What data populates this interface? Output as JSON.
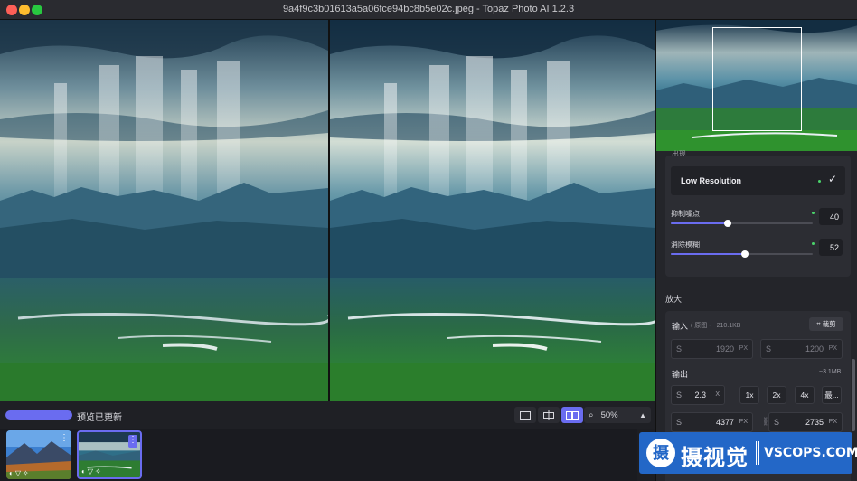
{
  "window": {
    "title": "9a4f9c3b01613a5a06fce94bc8b5e02c.jpeg - Topaz Photo AI 1.2.3"
  },
  "bottombar": {
    "status": "预览已更新",
    "zoom": "50%",
    "progress": 1.0
  },
  "panel": {
    "clipped_heading": "出现",
    "model": {
      "label": "Low Resolution"
    },
    "sliders": [
      {
        "label": "抑制噪点",
        "value": "40",
        "level": 0.4
      },
      {
        "label": "消除模糊",
        "value": "52",
        "level": 0.52
      }
    ],
    "upscale": {
      "section_title": "放大",
      "input_label": "输入",
      "input_meta": "( 原图 - ~210.1KB",
      "crop_label": "裁剪",
      "input_width": "1920",
      "input_height": "1200",
      "unit": "PX",
      "field_prefix": "S",
      "output_label": "输出",
      "output_size": "~3.1MB",
      "scale_value": "2.3",
      "scale_unit": "X",
      "scale_buttons": [
        "1x",
        "2x",
        "4x",
        "最..."
      ],
      "output_width": "4377",
      "output_height": "2735"
    }
  },
  "watermark": {
    "seal": "摄",
    "cn": "摄视觉",
    "en": "VSCOPS.COM"
  },
  "colors": {
    "accent": "#6a6cf0",
    "active_dot": "#4ad36b",
    "watermark_blue": "#2367c7"
  }
}
